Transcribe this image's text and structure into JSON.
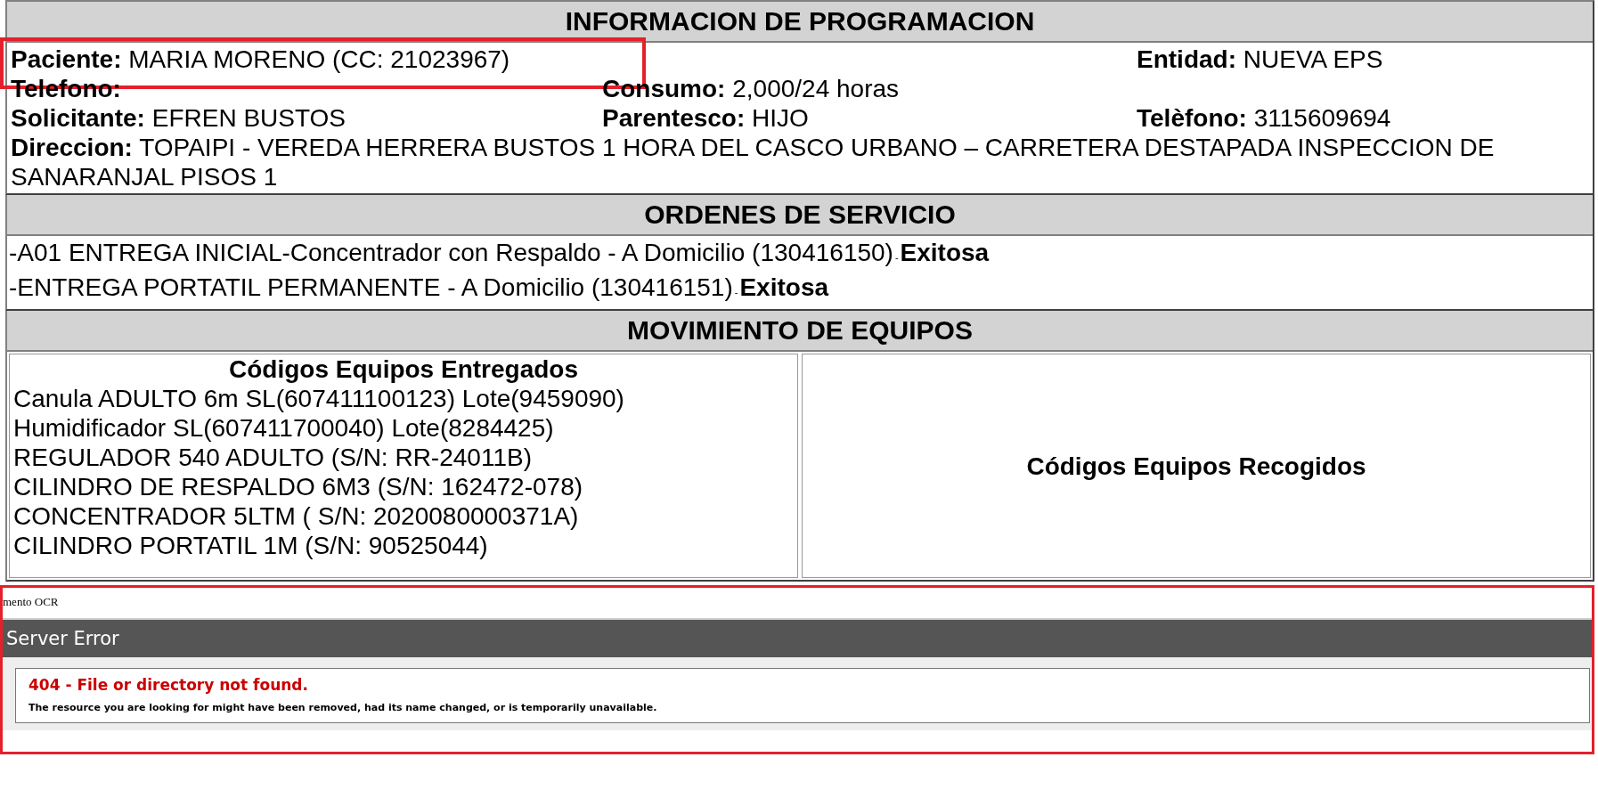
{
  "programacion": {
    "title": "INFORMACION DE PROGRAMACION",
    "rows": [
      [
        {
          "label": "Paciente:",
          "value": "MARIA MORENO (CC: 21023967)",
          "highlighted": true
        },
        null,
        {
          "label": "Entidad:",
          "value": "NUEVA EPS",
          "highlighted": false
        }
      ],
      [
        {
          "label": "Telefono:",
          "highlighted": false
        },
        {
          "label": "Consumo:",
          "value": "2,000/24 horas",
          "highlighted": false
        },
        null
      ],
      [
        {
          "label": "Solicitante:",
          "value": "EFREN BUSTOS",
          "highlighted": false
        },
        {
          "label": "Parentesco:",
          "value": "HIJO",
          "highlighted": false
        },
        {
          "label": "Telèfono:",
          "value": "3115609694",
          "highlighted": false
        }
      ]
    ],
    "direccion": {
      "label": "Direccion:",
      "value": "TOPAIPI - VEREDA HERRERA BUSTOS 1 HORA DEL CASCO URBANO – CARRETERA DESTAPADA INSPECCION DE SANARANJAL PISOS 1"
    }
  },
  "ordenes": {
    "title": "ORDENES DE SERVICIO",
    "items": [
      {
        "text": "-A01 ENTREGA INICIAL-Concentrador con Respaldo - A Domicilio (130416150)",
        "separator": "-",
        "status": "Exitosa"
      },
      {
        "text": "-ENTREGA PORTATIL PERMANENTE - A Domicilio (130416151)",
        "separator": "-",
        "status": "Exitosa"
      }
    ]
  },
  "movimiento": {
    "title": "MOVIMIENTO DE EQUIPOS",
    "entregados": {
      "title": "Códigos Equipos Entregados",
      "items": [
        "Canula ADULTO 6m SL(607411100123) Lote(9459090)",
        "Humidificador SL(607411700040) Lote(8284425)",
        "REGULADOR 540 ADULTO (S/N: RR-24011B)",
        "CILINDRO DE RESPALDO 6M3 (S/N: 162472-078)",
        "CONCENTRADOR 5LTM ( S/N: 2020080000371A)",
        "CILINDRO PORTATIL 1M (S/N: 90525044)"
      ]
    },
    "recogidos": {
      "title": "Códigos Equipos Recogidos"
    }
  },
  "error_frame": {
    "highlighted": true,
    "cut_text": "mento OCR",
    "header": "Server Error",
    "error_title": "404 - File or directory not found.",
    "error_message": "The resource you are looking for might have been removed, had its name changed, or is temporarily unavailable."
  }
}
